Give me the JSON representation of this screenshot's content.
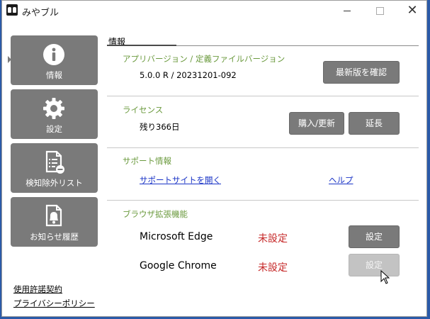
{
  "window": {
    "title": "みやブル"
  },
  "nav": {
    "items": [
      {
        "label": "情報"
      },
      {
        "label": "設定"
      },
      {
        "label": "検知除外リスト"
      },
      {
        "label": "お知らせ履歴"
      }
    ]
  },
  "footer": {
    "license": "使用許諾契約",
    "privacy": "プライバシーポリシー"
  },
  "content": {
    "title": "情報",
    "version": {
      "heading": "アプリバージョン / 定義ファイルバージョン",
      "value": "5.0.0 R / 20231201-092",
      "check_button": "最新版を確認"
    },
    "license": {
      "heading": "ライセンス",
      "remaining": "残り366日",
      "purchase_button": "購入/更新",
      "extend_button": "延長"
    },
    "support": {
      "heading": "サポート情報",
      "site_link": "サポートサイトを開く",
      "help_link": "ヘルプ"
    },
    "browser": {
      "heading": "ブラウザ拡張機能",
      "edge": {
        "name": "Microsoft Edge",
        "status": "未設定",
        "button": "設定"
      },
      "chrome": {
        "name": "Google Chrome",
        "status": "未設定",
        "button": "設定"
      }
    }
  },
  "colors": {
    "nav_bg": "#7a7a7a",
    "section_heading": "#6b9a3e",
    "status_unset": "#c62828",
    "link": "#1a34c6"
  }
}
